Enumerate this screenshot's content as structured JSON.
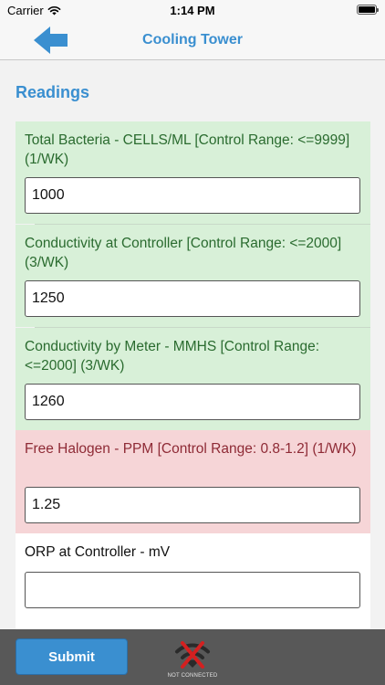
{
  "status_bar": {
    "carrier": "Carrier",
    "time": "1:14 PM"
  },
  "nav": {
    "title": "Cooling Tower",
    "back_icon": "back-arrow-icon",
    "accent_color": "#3a8fd0"
  },
  "section": {
    "title": "Readings"
  },
  "readings": [
    {
      "label": "Total Bacteria - CELLS/ML [Control Range: <=9999] (1/WK)",
      "value": "1000",
      "status": "in-range",
      "color": "#d8f0d8"
    },
    {
      "label": "Conductivity at Controller [Control Range: <=2000] (3/WK)",
      "value": "1250",
      "status": "in-range",
      "color": "#d8f0d8"
    },
    {
      "label": "Conductivity by Meter - MMHS [Control Range: <=2000] (3/WK)",
      "value": "1260",
      "status": "in-range",
      "color": "#d8f0d8"
    },
    {
      "label": "Free Halogen - PPM [Control Range: 0.8-1.2] (1/WK)",
      "value": "1.25",
      "status": "out-of-range",
      "color": "#f6d5d7"
    },
    {
      "label": "ORP at Controller - mV",
      "value": "",
      "status": "none",
      "color": "#ffffff"
    }
  ],
  "footer": {
    "submit_label": "Submit",
    "connection_status": "NOT CONNECTED",
    "connection_icon": "wifi-disconnected-icon"
  }
}
